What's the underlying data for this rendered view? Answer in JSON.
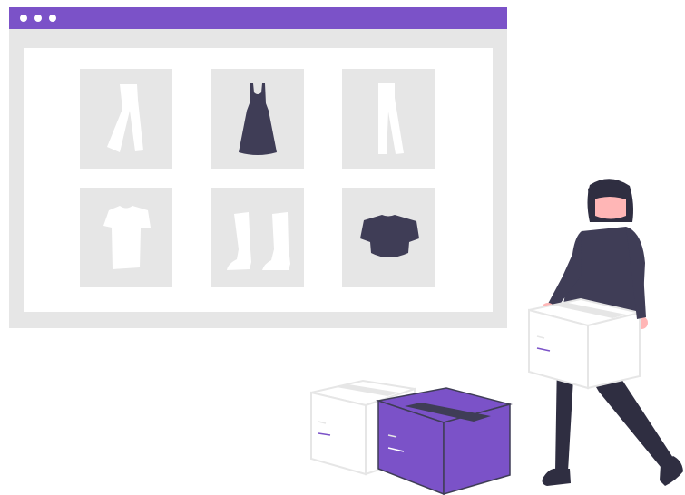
{
  "colors": {
    "accent": "#7b52c8",
    "frame": "#e6e6e6",
    "dark": "#3f3d56",
    "skin": "#ffb6b6",
    "hair": "#2f2e41",
    "white": "#ffffff"
  },
  "window": {
    "controls": [
      "window-dot",
      "window-dot",
      "window-dot"
    ]
  },
  "products": [
    {
      "icon": "pants-icon"
    },
    {
      "icon": "dress-icon"
    },
    {
      "icon": "trousers-icon"
    },
    {
      "icon": "tshirt-icon"
    },
    {
      "icon": "boots-icon"
    },
    {
      "icon": "crop-top-icon"
    }
  ]
}
